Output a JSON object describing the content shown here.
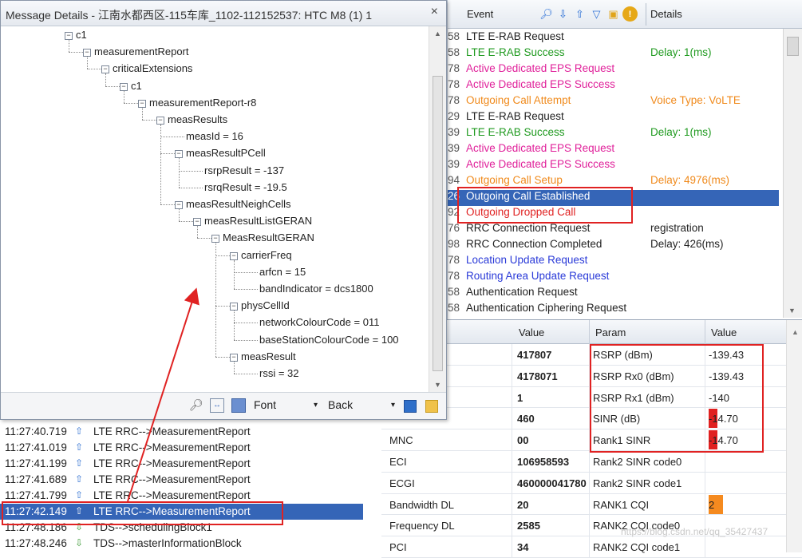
{
  "window": {
    "title": "Message Details - 江南水都西区-115车库_1102-112152537: HTC M8 (1) 1",
    "close": "×"
  },
  "tree": [
    {
      "label": "c1",
      "depth": 0,
      "box": "-"
    },
    {
      "label": "measurementReport",
      "depth": 1,
      "box": "-"
    },
    {
      "label": "criticalExtensions",
      "depth": 2,
      "box": "-"
    },
    {
      "label": "c1",
      "depth": 3,
      "box": "-"
    },
    {
      "label": "measurementReport-r8",
      "depth": 4,
      "box": "-"
    },
    {
      "label": "measResults",
      "depth": 5,
      "box": "-"
    },
    {
      "label": "measId = 16",
      "depth": 6,
      "box": ""
    },
    {
      "label": "measResultPCell",
      "depth": 6,
      "box": "-"
    },
    {
      "label": "rsrpResult = -137",
      "depth": 7,
      "box": ""
    },
    {
      "label": "rsrqResult = -19.5",
      "depth": 7,
      "box": ""
    },
    {
      "label": "measResultNeighCells",
      "depth": 6,
      "box": "-"
    },
    {
      "label": "measResultListGERAN",
      "depth": 7,
      "box": "-"
    },
    {
      "label": "MeasResultGERAN",
      "depth": 8,
      "box": "-"
    },
    {
      "label": "carrierFreq",
      "depth": 9,
      "box": "-"
    },
    {
      "label": "arfcn = 15",
      "depth": 10,
      "box": ""
    },
    {
      "label": "bandIndicator = dcs1800",
      "depth": 10,
      "box": ""
    },
    {
      "label": "physCellId",
      "depth": 9,
      "box": "-"
    },
    {
      "label": "networkColourCode = 011",
      "depth": 10,
      "box": ""
    },
    {
      "label": "baseStationColourCode = 100",
      "depth": 10,
      "box": ""
    },
    {
      "label": "measResult",
      "depth": 9,
      "box": "-"
    },
    {
      "label": "rssi = 32",
      "depth": 10,
      "box": ""
    }
  ],
  "toolbar": {
    "font_label": "Font",
    "back_label": "Back"
  },
  "event_header": {
    "event": "Event",
    "details": "Details"
  },
  "events": [
    {
      "num": "58",
      "event": "LTE E-RAB Request",
      "details": "",
      "color": "#222222"
    },
    {
      "num": "58",
      "event": "LTE E-RAB Success",
      "details": "Delay: 1(ms)",
      "color": "#1f9a1f"
    },
    {
      "num": "78",
      "event": "Active Dedicated EPS Request",
      "details": "",
      "color": "#e0209a"
    },
    {
      "num": "78",
      "event": "Active Dedicated EPS Success",
      "details": "",
      "color": "#e0209a"
    },
    {
      "num": "78",
      "event": "Outgoing Call Attempt",
      "details": "Voice Type: VoLTE",
      "color": "#f08a1c"
    },
    {
      "num": "29",
      "event": "LTE E-RAB Request",
      "details": "",
      "color": "#222222"
    },
    {
      "num": "39",
      "event": "LTE E-RAB Success",
      "details": "Delay: 1(ms)",
      "color": "#1f9a1f"
    },
    {
      "num": "39",
      "event": "Active Dedicated EPS Request",
      "details": "",
      "color": "#e0209a"
    },
    {
      "num": "39",
      "event": "Active Dedicated EPS Success",
      "details": "",
      "color": "#e0209a"
    },
    {
      "num": "94",
      "event": "Outgoing Call Setup",
      "details": "Delay: 4976(ms)",
      "color": "#f08a1c"
    },
    {
      "num": "26",
      "event": "Outgoing Call Established",
      "details": "",
      "color": "#ffffff",
      "selected": true
    },
    {
      "num": "92",
      "event": "Outgoing Dropped Call",
      "details": "",
      "color": "#e02222"
    },
    {
      "num": "76",
      "event": "RRC Connection Request",
      "details": "registration",
      "color": "#222222"
    },
    {
      "num": "98",
      "event": "RRC Connection Completed",
      "details": "Delay: 426(ms)",
      "color": "#222222"
    },
    {
      "num": "78",
      "event": "Location Update Request",
      "details": "",
      "color": "#2a3ad8"
    },
    {
      "num": "78",
      "event": "Routing Area Update Request",
      "details": "",
      "color": "#2a3ad8"
    },
    {
      "num": "58",
      "event": "Authentication Request",
      "details": "",
      "color": "#222222"
    },
    {
      "num": "58",
      "event": "Authentication Ciphering Request",
      "details": "",
      "color": "#222222"
    }
  ],
  "param_header": {
    "value1": "Value",
    "param": "Param",
    "value2": "Value"
  },
  "params": [
    {
      "name": "",
      "value": "417807",
      "param": "RSRP (dBm)",
      "pvalue": "-139.43",
      "mark": ""
    },
    {
      "name": "",
      "value": "4178071",
      "param": "RSRP Rx0 (dBm)",
      "pvalue": "-139.43",
      "mark": ""
    },
    {
      "name": "",
      "value": "1",
      "param": "RSRP Rx1 (dBm)",
      "pvalue": "-140",
      "mark": ""
    },
    {
      "name": "",
      "value": "460",
      "param": "SINR (dB)",
      "pvalue": "-14.70",
      "mark": "red"
    },
    {
      "name": "MNC",
      "value": "00",
      "param": "Rank1 SINR",
      "pvalue": "-14.70",
      "mark": "red"
    },
    {
      "name": "ECI",
      "value": "106958593",
      "param": "Rank2 SINR code0",
      "pvalue": "",
      "mark": ""
    },
    {
      "name": "ECGI",
      "value": "460000041780",
      "param": "Rank2 SINR code1",
      "pvalue": "",
      "mark": ""
    },
    {
      "name": "Bandwidth DL",
      "value": "20",
      "param": "RANK1 CQI",
      "pvalue": "2",
      "mark": "orange"
    },
    {
      "name": "Frequency DL",
      "value": "2585",
      "param": "RANK2 CQI code0",
      "pvalue": "",
      "mark": ""
    },
    {
      "name": "PCI",
      "value": "34",
      "param": "RANK2 CQI code1",
      "pvalue": "",
      "mark": ""
    }
  ],
  "messages": [
    {
      "time": "11:27:40.719",
      "dir": "up",
      "msg": "LTE RRC-->MeasurementReport"
    },
    {
      "time": "11:27:41.019",
      "dir": "up",
      "msg": "LTE RRC-->MeasurementReport"
    },
    {
      "time": "11:27:41.199",
      "dir": "up",
      "msg": "LTE RRC-->MeasurementReport"
    },
    {
      "time": "11:27:41.689",
      "dir": "up",
      "msg": "LTE RRC-->MeasurementReport"
    },
    {
      "time": "11:27:41.799",
      "dir": "up",
      "msg": "LTE RRC-->MeasurementReport"
    },
    {
      "time": "11:27:42.149",
      "dir": "up",
      "msg": "LTE RRC-->MeasurementReport",
      "selected": true
    },
    {
      "time": "11:27:48.186",
      "dir": "down",
      "msg": "TDS-->schedulingBlock1"
    },
    {
      "time": "11:27:48.246",
      "dir": "down",
      "msg": "TDS-->masterInformationBlock"
    }
  ],
  "watermark": "https://blog.csdn.net/qq_35427437",
  "colors": {
    "selection": "#3565b7",
    "highlight_box": "#e02222",
    "arrow": "#e02222"
  }
}
